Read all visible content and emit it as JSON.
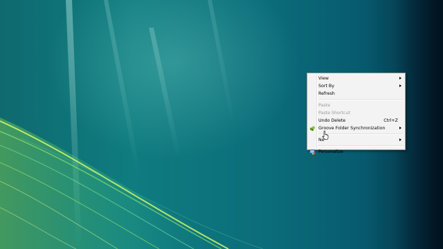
{
  "desktop": {
    "context_menu": {
      "items": [
        {
          "label": "View",
          "submenu": true
        },
        {
          "label": "Sort By",
          "submenu": true
        },
        {
          "label": "Refresh"
        },
        {
          "label": "Paste",
          "disabled": true
        },
        {
          "label": "Paste Shortcut",
          "disabled": true
        },
        {
          "label": "Undo Delete",
          "shortcut": "Ctrl+Z"
        },
        {
          "label": "Groove Folder Synchronization",
          "submenu": true,
          "icon": "groove-icon"
        },
        {
          "label": "Ne",
          "submenu": true
        },
        {
          "label": "Personalize",
          "icon": "personalize-icon"
        }
      ]
    }
  },
  "colors": {
    "menu_background": "#f3f3f3",
    "menu_border": "#979797",
    "disabled_text": "#9a9a9a"
  }
}
